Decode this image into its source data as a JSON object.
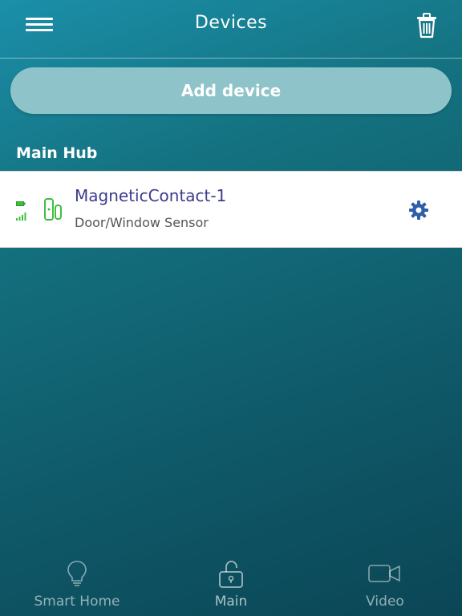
{
  "header": {
    "title": "Devices"
  },
  "actions": {
    "add_device_label": "Add device"
  },
  "section": {
    "label": "Main Hub"
  },
  "devices": [
    {
      "name": "MagneticContact-1",
      "type": "Door/Window Sensor",
      "icon": "door-window-sensor-icon",
      "battery_icon": "battery-icon",
      "signal_icon": "signal-strength-icon",
      "status_color": "#3fbf3f"
    }
  ],
  "tabs": [
    {
      "label": "Smart Home",
      "icon": "lightbulb-icon"
    },
    {
      "label": "Main",
      "icon": "unlocked-padlock-icon"
    },
    {
      "label": "Video",
      "icon": "video-camera-icon"
    }
  ],
  "colors": {
    "accent_text": "#3b3b8f",
    "gear": "#2e5fa8",
    "add_button": "#8ec3c9",
    "background_top": "#1b8fa9",
    "background_bottom": "#0b4655"
  }
}
